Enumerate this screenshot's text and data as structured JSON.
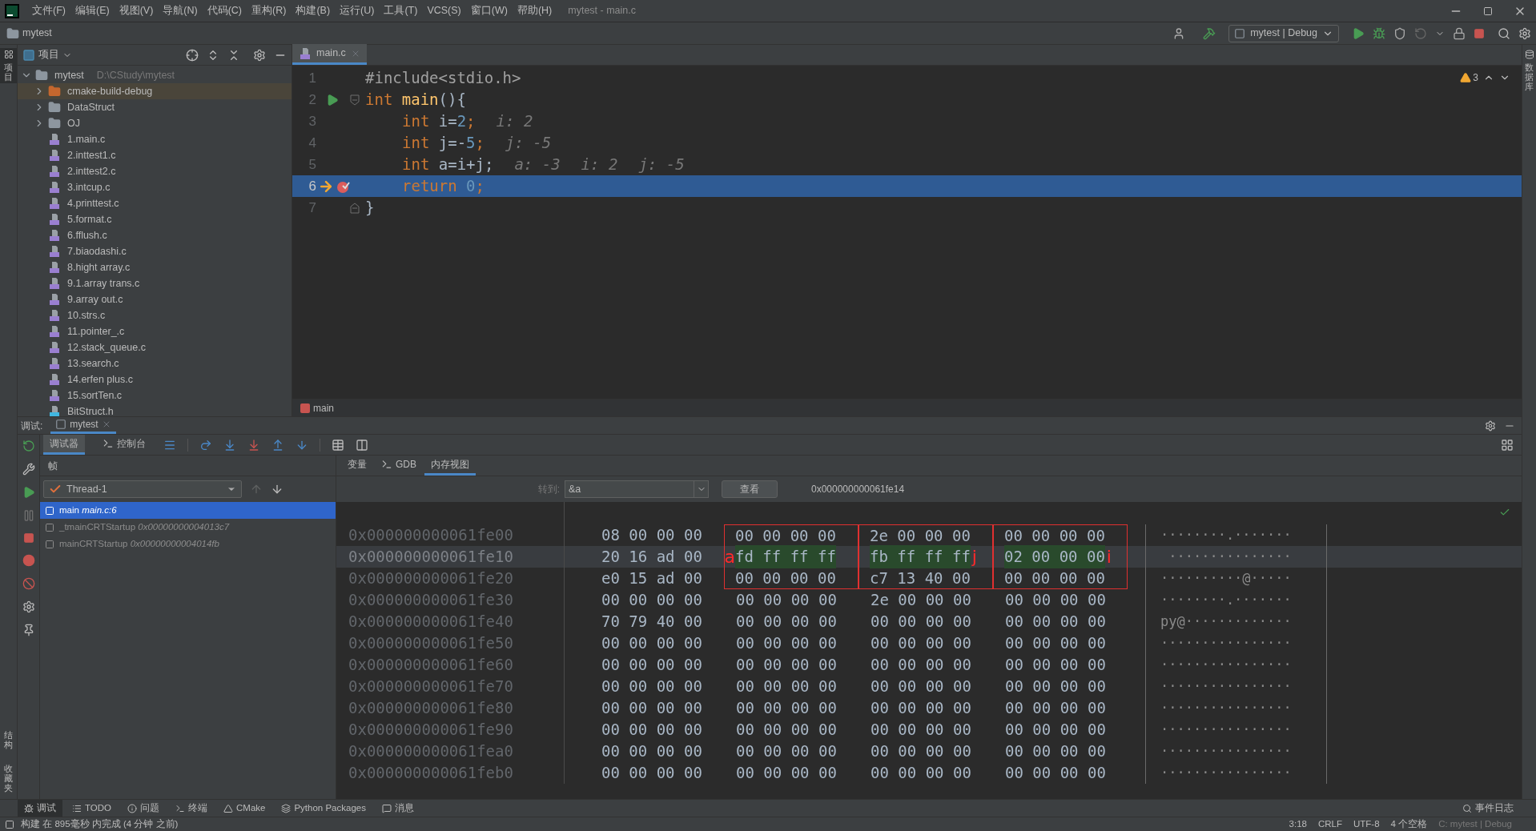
{
  "menu": [
    "文件(F)",
    "编辑(E)",
    "视图(V)",
    "导航(N)",
    "代码(C)",
    "重构(R)",
    "构建(B)",
    "运行(U)",
    "工具(T)",
    "VCS(S)",
    "窗口(W)",
    "帮助(H)"
  ],
  "window": {
    "title": "mytest - main.c"
  },
  "nav": {
    "project": "mytest",
    "run_config": "mytest | Debug"
  },
  "left_strip": {
    "top": "项目",
    "bottom": [
      "结构",
      "收藏夹"
    ]
  },
  "right_strip": {
    "label": "数据库"
  },
  "project": {
    "title": "项目",
    "tree": [
      {
        "name": "mytest",
        "path": "D:\\CStudy\\mytest",
        "kind": "folder",
        "expanded": true,
        "selected": false,
        "children": [
          {
            "name": "cmake-build-debug",
            "kind": "build_folder",
            "expanded": false,
            "selected": true
          },
          {
            "name": "DataStruct",
            "kind": "folder",
            "expanded": false,
            "selected": false
          },
          {
            "name": "OJ",
            "kind": "folder",
            "expanded": false,
            "selected": false
          },
          {
            "name": "1.main.c",
            "kind": "c_file",
            "selected": false
          },
          {
            "name": "2.inttest1.c",
            "kind": "c_file",
            "selected": false
          },
          {
            "name": "2.inttest2.c",
            "kind": "c_file",
            "selected": false
          },
          {
            "name": "3.intcup.c",
            "kind": "c_file",
            "selected": false
          },
          {
            "name": "4.printtest.c",
            "kind": "c_file",
            "selected": false
          },
          {
            "name": "5.format.c",
            "kind": "c_file",
            "selected": false
          },
          {
            "name": "6.fflush.c",
            "kind": "c_file",
            "selected": false
          },
          {
            "name": "7.biaodashi.c",
            "kind": "c_file",
            "selected": false
          },
          {
            "name": "8.hight array.c",
            "kind": "c_file",
            "selected": false
          },
          {
            "name": "9.1.array trans.c",
            "kind": "c_file",
            "selected": false
          },
          {
            "name": "9.array out.c",
            "kind": "c_file",
            "selected": false
          },
          {
            "name": "10.strs.c",
            "kind": "c_file",
            "selected": false
          },
          {
            "name": "11.pointer_.c",
            "kind": "c_file",
            "selected": false
          },
          {
            "name": "12.stack_queue.c",
            "kind": "c_file",
            "selected": false
          },
          {
            "name": "13.search.c",
            "kind": "c_file",
            "selected": false
          },
          {
            "name": "14.erfen plus.c",
            "kind": "c_file",
            "selected": false
          },
          {
            "name": "15.sortTen.c",
            "kind": "c_file",
            "selected": false
          },
          {
            "name": "BitStruct.h",
            "kind": "h_file",
            "selected": false
          }
        ]
      }
    ]
  },
  "editor": {
    "tab": "main.c",
    "warnings": "3",
    "breadcrumb": "main",
    "lines": [
      {
        "number": "1",
        "current": false,
        "indented": false,
        "tokens": [
          {
            "text": "#include<stdio.h>",
            "kind": "macro"
          }
        ]
      },
      {
        "number": "2",
        "current": false,
        "indented": false,
        "runnable": true,
        "fold_start": true,
        "tokens": [
          {
            "text": "int",
            "kind": "keyword"
          },
          {
            "text": "main",
            "kind": "function",
            "space_before": true
          },
          {
            "text": "(){",
            "kind": "plain"
          }
        ]
      },
      {
        "number": "3",
        "current": false,
        "indented": true,
        "tokens": [
          {
            "text": "int",
            "kind": "keyword"
          },
          {
            "text": "i=",
            "kind": "plain",
            "space_before": true
          },
          {
            "text": "2",
            "kind": "number"
          },
          {
            "text": ";",
            "kind": "keyword"
          },
          {
            "text": "i: 2",
            "kind": "hint"
          }
        ]
      },
      {
        "number": "4",
        "current": false,
        "indented": true,
        "tokens": [
          {
            "text": "int",
            "kind": "keyword"
          },
          {
            "text": "j=-",
            "kind": "plain",
            "space_before": true
          },
          {
            "text": "5",
            "kind": "number"
          },
          {
            "text": ";",
            "kind": "keyword"
          },
          {
            "text": "j: -5",
            "kind": "hint"
          }
        ]
      },
      {
        "number": "5",
        "current": false,
        "indented": true,
        "tokens": [
          {
            "text": "int",
            "kind": "keyword"
          },
          {
            "text": "a=i+j;",
            "kind": "plain",
            "space_before": true
          },
          {
            "text": "a: -3",
            "kind": "hint"
          },
          {
            "text": "i: 2",
            "kind": "hint"
          },
          {
            "text": "j: -5",
            "kind": "hint"
          }
        ]
      },
      {
        "number": "6",
        "current": true,
        "indented": true,
        "breakpoint": true,
        "tokens": [
          {
            "text": "return",
            "kind": "keyword"
          },
          {
            "text": "0",
            "kind": "number",
            "space_before": true
          },
          {
            "text": ";",
            "kind": "keyword"
          }
        ]
      },
      {
        "number": "7",
        "current": false,
        "indented": false,
        "fold_end": true,
        "tokens": [
          {
            "text": "}",
            "kind": "plain"
          }
        ]
      }
    ]
  },
  "debug": {
    "title": "调试:",
    "session": "mytest",
    "tabs": [
      {
        "label": "调试器",
        "selected": true
      },
      {
        "label": "控制台",
        "selected": false
      }
    ],
    "frames_title": "帧",
    "thread": "Thread-1",
    "frames": [
      {
        "name": "main",
        "location": "main.c:6",
        "selected": true
      },
      {
        "name": "_tmainCRTStartup",
        "location": "0x00000000004013c7",
        "selected": false
      },
      {
        "name": "mainCRTStartup",
        "location": "0x00000000004014fb",
        "selected": false
      }
    ],
    "view_tabs": [
      {
        "label": "变量",
        "selected": false
      },
      {
        "label": "GDB",
        "selected": false
      },
      {
        "label": "内存视图",
        "selected": true
      }
    ],
    "goto_label": "转到:",
    "goto_value": "&a",
    "view_button": "查看",
    "address": "0x000000000061fe14",
    "memory": [
      {
        "address": "0x000000000061fe00",
        "highlighted": false,
        "ascii": "········.·······",
        "groups": [
          {
            "bytes": "08 00 00 00",
            "changed": false,
            "boxed": false
          },
          {
            "bytes": "00 00 00 00",
            "changed": false,
            "boxed": true
          },
          {
            "bytes": "2e 00 00 00",
            "changed": false,
            "boxed": true
          },
          {
            "bytes": "00 00 00 00",
            "changed": false,
            "boxed": true
          }
        ]
      },
      {
        "address": "0x000000000061fe10",
        "highlighted": true,
        "ascii": " ···············",
        "groups": [
          {
            "bytes": "20 16 ad 00",
            "changed": false,
            "boxed": false
          },
          {
            "bytes": "fd ff ff ff",
            "changed": true,
            "boxed": true,
            "note": "a",
            "note_left": true
          },
          {
            "bytes": "fb ff ff ff",
            "changed": true,
            "boxed": true,
            "note": "j",
            "note_left": false
          },
          {
            "bytes": "02 00 00 00",
            "changed": true,
            "boxed": true,
            "note": "i",
            "note_left": false
          }
        ]
      },
      {
        "address": "0x000000000061fe20",
        "highlighted": false,
        "ascii": "··········@·····",
        "groups": [
          {
            "bytes": "e0 15 ad 00",
            "changed": false,
            "boxed": false
          },
          {
            "bytes": "00 00 00 00",
            "changed": false,
            "boxed": true
          },
          {
            "bytes": "c7 13 40 00",
            "changed": false,
            "boxed": true
          },
          {
            "bytes": "00 00 00 00",
            "changed": false,
            "boxed": true
          }
        ]
      },
      {
        "address": "0x000000000061fe30",
        "highlighted": false,
        "ascii": "········.·······",
        "groups": [
          {
            "bytes": "00 00 00 00",
            "changed": false,
            "boxed": false
          },
          {
            "bytes": "00 00 00 00",
            "changed": false,
            "boxed": false
          },
          {
            "bytes": "2e 00 00 00",
            "changed": false,
            "boxed": false
          },
          {
            "bytes": "00 00 00 00",
            "changed": false,
            "boxed": false
          }
        ]
      },
      {
        "address": "0x000000000061fe40",
        "highlighted": false,
        "ascii": "py@·············",
        "groups": [
          {
            "bytes": "70 79 40 00",
            "changed": false,
            "boxed": false
          },
          {
            "bytes": "00 00 00 00",
            "changed": false,
            "boxed": false
          },
          {
            "bytes": "00 00 00 00",
            "changed": false,
            "boxed": false
          },
          {
            "bytes": "00 00 00 00",
            "changed": false,
            "boxed": false
          }
        ]
      },
      {
        "address": "0x000000000061fe50",
        "highlighted": false,
        "ascii": "················",
        "groups": [
          {
            "bytes": "00 00 00 00",
            "changed": false,
            "boxed": false
          },
          {
            "bytes": "00 00 00 00",
            "changed": false,
            "boxed": false
          },
          {
            "bytes": "00 00 00 00",
            "changed": false,
            "boxed": false
          },
          {
            "bytes": "00 00 00 00",
            "changed": false,
            "boxed": false
          }
        ]
      },
      {
        "address": "0x000000000061fe60",
        "highlighted": false,
        "ascii": "················",
        "groups": [
          {
            "bytes": "00 00 00 00",
            "changed": false,
            "boxed": false
          },
          {
            "bytes": "00 00 00 00",
            "changed": false,
            "boxed": false
          },
          {
            "bytes": "00 00 00 00",
            "changed": false,
            "boxed": false
          },
          {
            "bytes": "00 00 00 00",
            "changed": false,
            "boxed": false
          }
        ]
      },
      {
        "address": "0x000000000061fe70",
        "highlighted": false,
        "ascii": "················",
        "groups": [
          {
            "bytes": "00 00 00 00",
            "changed": false,
            "boxed": false
          },
          {
            "bytes": "00 00 00 00",
            "changed": false,
            "boxed": false
          },
          {
            "bytes": "00 00 00 00",
            "changed": false,
            "boxed": false
          },
          {
            "bytes": "00 00 00 00",
            "changed": false,
            "boxed": false
          }
        ]
      },
      {
        "address": "0x000000000061fe80",
        "highlighted": false,
        "ascii": "················",
        "groups": [
          {
            "bytes": "00 00 00 00",
            "changed": false,
            "boxed": false
          },
          {
            "bytes": "00 00 00 00",
            "changed": false,
            "boxed": false
          },
          {
            "bytes": "00 00 00 00",
            "changed": false,
            "boxed": false
          },
          {
            "bytes": "00 00 00 00",
            "changed": false,
            "boxed": false
          }
        ]
      },
      {
        "address": "0x000000000061fe90",
        "highlighted": false,
        "ascii": "················",
        "groups": [
          {
            "bytes": "00 00 00 00",
            "changed": false,
            "boxed": false
          },
          {
            "bytes": "00 00 00 00",
            "changed": false,
            "boxed": false
          },
          {
            "bytes": "00 00 00 00",
            "changed": false,
            "boxed": false
          },
          {
            "bytes": "00 00 00 00",
            "changed": false,
            "boxed": false
          }
        ]
      },
      {
        "address": "0x000000000061fea0",
        "highlighted": false,
        "ascii": "················",
        "groups": [
          {
            "bytes": "00 00 00 00",
            "changed": false,
            "boxed": false
          },
          {
            "bytes": "00 00 00 00",
            "changed": false,
            "boxed": false
          },
          {
            "bytes": "00 00 00 00",
            "changed": false,
            "boxed": false
          },
          {
            "bytes": "00 00 00 00",
            "changed": false,
            "boxed": false
          }
        ]
      },
      {
        "address": "0x000000000061feb0",
        "highlighted": false,
        "ascii": "················",
        "groups": [
          {
            "bytes": "00 00 00 00",
            "changed": false,
            "boxed": false
          },
          {
            "bytes": "00 00 00 00",
            "changed": false,
            "boxed": false
          },
          {
            "bytes": "00 00 00 00",
            "changed": false,
            "boxed": false
          },
          {
            "bytes": "00 00 00 00",
            "changed": false,
            "boxed": false
          }
        ]
      }
    ]
  },
  "tool_tabs": [
    {
      "label": "调试",
      "kind": "debug",
      "selected": true
    },
    {
      "label": "TODO",
      "kind": "todo",
      "selected": false
    },
    {
      "label": "问题",
      "kind": "problems",
      "selected": false
    },
    {
      "label": "终端",
      "kind": "terminal",
      "selected": false
    },
    {
      "label": "CMake",
      "kind": "cmake",
      "selected": false
    },
    {
      "label": "Python Packages",
      "kind": "packages",
      "selected": false
    },
    {
      "label": "消息",
      "kind": "messages",
      "selected": false
    }
  ],
  "event_log": "事件日志",
  "status_bar": {
    "message": "构建 在 895毫秒 内完成 (4 分钟 之前)",
    "items": [
      "3:18",
      "CRLF",
      "UTF-8",
      "4 个空格",
      "C: mytest | Debug"
    ]
  }
}
